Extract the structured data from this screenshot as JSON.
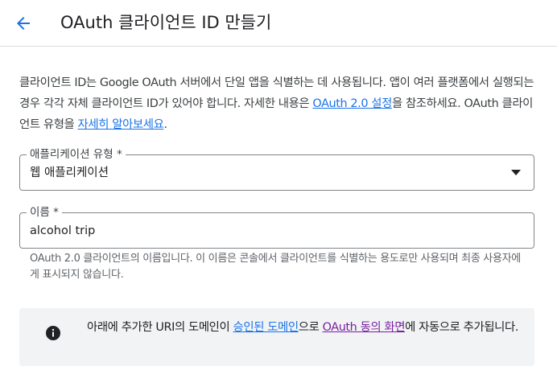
{
  "header": {
    "back_icon": "arrow-back-icon",
    "title": "OAuth 클라이언트 ID 만들기",
    "accent_color": "#1a73e8"
  },
  "intro": {
    "text1": "클라이언트 ID는 Google OAuth 서버에서 단일 앱을 식별하는 데 사용됩니다. 앱이 여러 플랫폼에서 실행되는 경우 각각 자체 클라이언트 ID가 있어야 합니다. 자세한 내용은 ",
    "link1": "OAuth 2.0 설정",
    "text2": "을 참조하세요. OAuth 클라이언트 유형을 ",
    "link2": "자세히 알아보세요",
    "text3": "."
  },
  "app_type": {
    "label": "애플리케이션 유형 *",
    "value": "웹 애플리케이션",
    "icon": "dropdown-arrow-icon"
  },
  "name_field": {
    "label": "이름 *",
    "value": "alcohol trip"
  },
  "name_hint": "OAuth 2.0 클라이언트의 이름입니다. 이 이름은 콘솔에서 클라이언트를 식별하는 용도로만 사용되며 최종 사용자에게 표시되지 않습니다.",
  "notice": {
    "icon": "info-icon",
    "text1": "아래에 추가한 URI의 도메인이 ",
    "link1": "승인된 도메인",
    "text2": "으로 ",
    "link2": "OAuth 동의 화면",
    "text3": "에 자동으로 추가됩니다."
  }
}
